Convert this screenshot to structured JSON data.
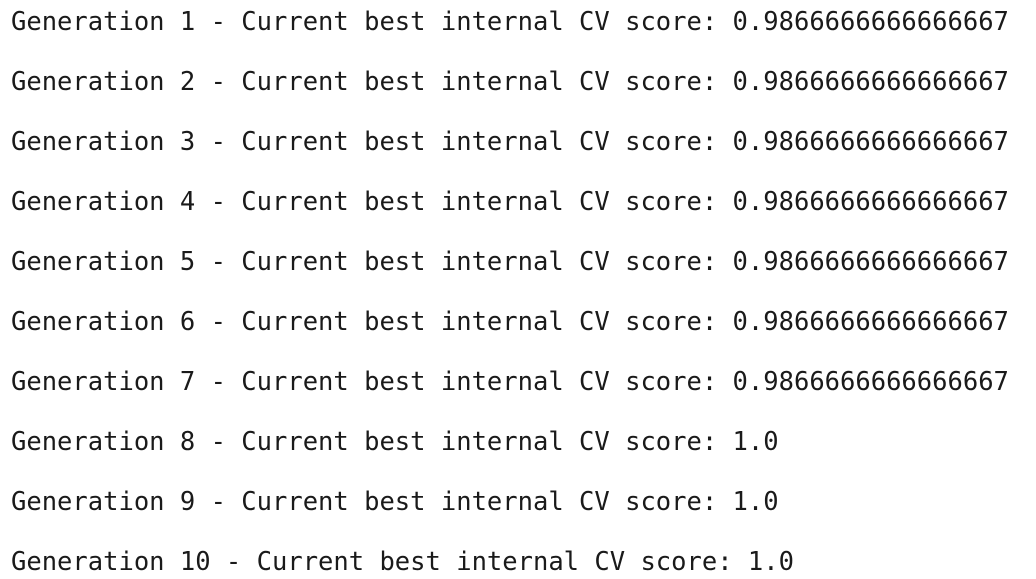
{
  "console": {
    "lines": [
      "Generation 1 - Current best internal CV score: 0.9866666666666667",
      "Generation 2 - Current best internal CV score: 0.9866666666666667",
      "Generation 3 - Current best internal CV score: 0.9866666666666667",
      "Generation 4 - Current best internal CV score: 0.9866666666666667",
      "Generation 5 - Current best internal CV score: 0.9866666666666667",
      "Generation 6 - Current best internal CV score: 0.9866666666666667",
      "Generation 7 - Current best internal CV score: 0.9866666666666667",
      "Generation 8 - Current best internal CV score: 1.0",
      "Generation 9 - Current best internal CV score: 1.0",
      "Generation 10 - Current best internal CV score: 1.0"
    ]
  },
  "colors": {
    "text": "#1a1a1a",
    "background": "#ffffff"
  }
}
